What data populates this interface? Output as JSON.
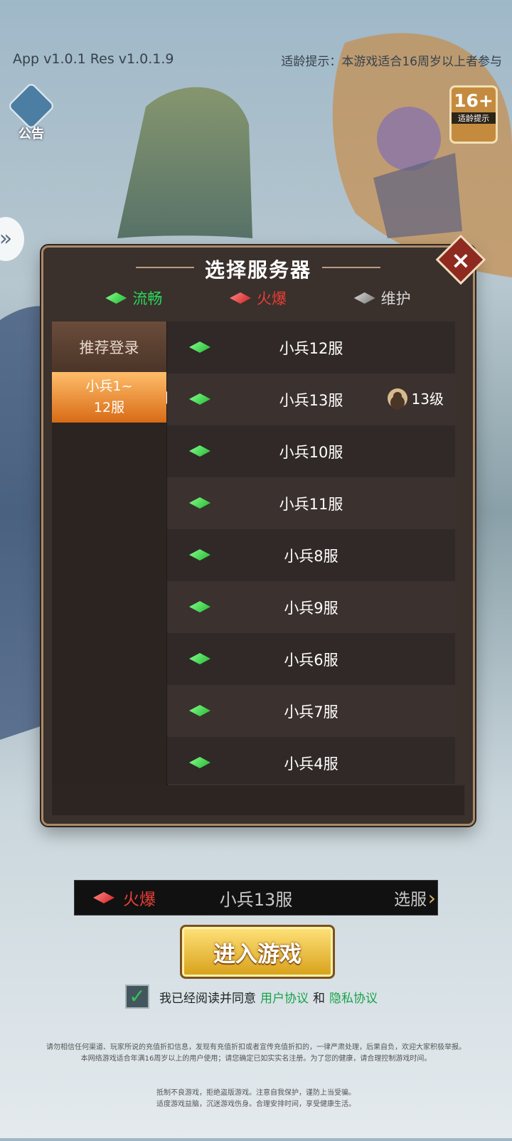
{
  "top": {
    "version": "App v1.0.1  Res v1.0.1.9",
    "age_tip": "适龄提示：本游戏适合16周岁以上者参与",
    "notice_label": "公告",
    "age_badge": {
      "number": "16+",
      "caption": "适龄提示"
    }
  },
  "dialog": {
    "title": "选择服务器",
    "legend": [
      {
        "label": "流畅",
        "color": "#29d85a",
        "icon": "green-gem-icon"
      },
      {
        "label": "火爆",
        "color": "#e83f36",
        "icon": "red-gem-icon"
      },
      {
        "label": "维护",
        "color": "#d8d8d8",
        "icon": "gray-gem-icon"
      }
    ],
    "left_tabs": [
      "推荐登录",
      "小兵1~\n12服"
    ],
    "servers": [
      {
        "name": "小兵12服",
        "status": "green"
      },
      {
        "name": "小兵13服",
        "status": "green",
        "level": "13级"
      },
      {
        "name": "小兵10服",
        "status": "green"
      },
      {
        "name": "小兵11服",
        "status": "green"
      },
      {
        "name": "小兵8服",
        "status": "green"
      },
      {
        "name": "小兵9服",
        "status": "green"
      },
      {
        "name": "小兵6服",
        "status": "green"
      },
      {
        "name": "小兵7服",
        "status": "green"
      },
      {
        "name": "小兵4服",
        "status": "green"
      }
    ]
  },
  "selection": {
    "status": "火爆",
    "server_name": "小兵13服",
    "change_label": "选服"
  },
  "enter_button": "进入游戏",
  "agreement": {
    "text": "我已经阅读并同意",
    "user_link": "用户协议",
    "conjunction": "和",
    "privacy_link": "隐私协议"
  },
  "disclaimer_lines": [
    "请勿相信任何渠道、玩家所说的充值折扣信息，发现有充值折扣或者宣传充值折扣的，一律严肃处理，后果自负，欢迎大家积极举报。",
    "本网络游戏适合年满16周岁以上的用户使用；请您确定已如实实名注册。为了您的健康，请合理控制游戏时间。"
  ],
  "health_lines": [
    "抵制不良游戏，拒绝盗版游戏。注意自我保护，谨防上当受骗。",
    "适度游戏益脑，沉迷游戏伤身。合理安排时间，享受健康生活。"
  ]
}
